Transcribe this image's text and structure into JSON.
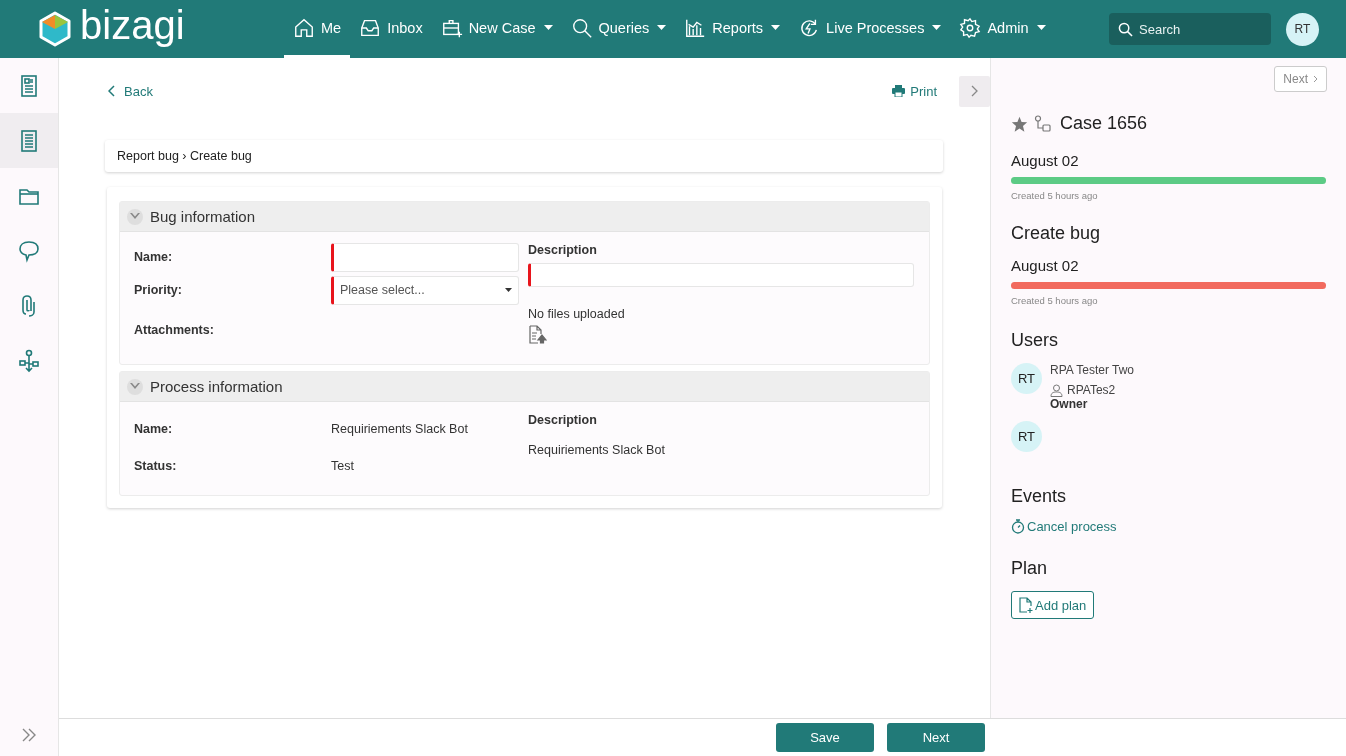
{
  "header": {
    "logo": "bizagi",
    "nav": [
      {
        "label": "Me",
        "selected": true,
        "dropdown": false
      },
      {
        "label": "Inbox",
        "selected": false,
        "dropdown": false
      },
      {
        "label": "New Case",
        "selected": false,
        "dropdown": true
      },
      {
        "label": "Queries",
        "selected": false,
        "dropdown": true
      },
      {
        "label": "Reports",
        "selected": false,
        "dropdown": true
      },
      {
        "label": "Live Processes",
        "selected": false,
        "dropdown": true
      },
      {
        "label": "Admin",
        "selected": false,
        "dropdown": true
      }
    ],
    "search": {
      "placeholder": "Search"
    },
    "avatar": "RT"
  },
  "sidebar": {
    "items": [
      {
        "selected": false
      },
      {
        "selected": true
      },
      {
        "selected": false
      },
      {
        "selected": false
      },
      {
        "selected": false
      },
      {
        "selected": false
      }
    ]
  },
  "toolbar": {
    "back": "Back",
    "print": "Print"
  },
  "breadcrumb": "Report bug › Create bug",
  "sections": [
    {
      "title": "Bug information",
      "expanded": true,
      "left": [
        {
          "label": "Name:",
          "kind": "input",
          "required": true
        },
        {
          "label": "Priority:",
          "kind": "select",
          "required": true,
          "placeholder": "Please select..."
        },
        {
          "label": "Attachments:",
          "kind": "none"
        }
      ],
      "right": [
        {
          "label": "Description",
          "kind": "input",
          "required": true
        },
        {
          "kind": "upload",
          "text": "No files uploaded"
        }
      ]
    },
    {
      "title": "Process information",
      "expanded": true,
      "left": [
        {
          "label": "Name:",
          "kind": "text",
          "value": "Requiriements Slack Bot"
        },
        {
          "label": "Status:",
          "kind": "text",
          "value": "Test"
        }
      ],
      "right": [
        {
          "label": "Description",
          "kind": "text",
          "value": "Requiriements Slack Bot"
        }
      ]
    }
  ],
  "panel": {
    "next": "Next",
    "case_title": "Case 1656",
    "milestones": [
      {
        "date": "August 02",
        "level": 1,
        "color": "#5ccb85",
        "note": "Created 5 hours ago"
      },
      {
        "heading": "Create bug",
        "date": "August 02",
        "level": 1,
        "color": "#f26a5e",
        "note": "Created 5 hours ago"
      }
    ],
    "users": {
      "title": "Users",
      "items": [
        {
          "initials": "RT",
          "name": "RPA Tester Two",
          "username": "RPATes2",
          "role": "Owner"
        },
        {
          "initials": "RT"
        }
      ]
    },
    "events": {
      "title": "Events",
      "items": [
        "Cancel process"
      ]
    },
    "plan": {
      "title": "Plan",
      "button": "Add plan"
    }
  },
  "footer": {
    "buttons": [
      "Save",
      "Next"
    ]
  }
}
